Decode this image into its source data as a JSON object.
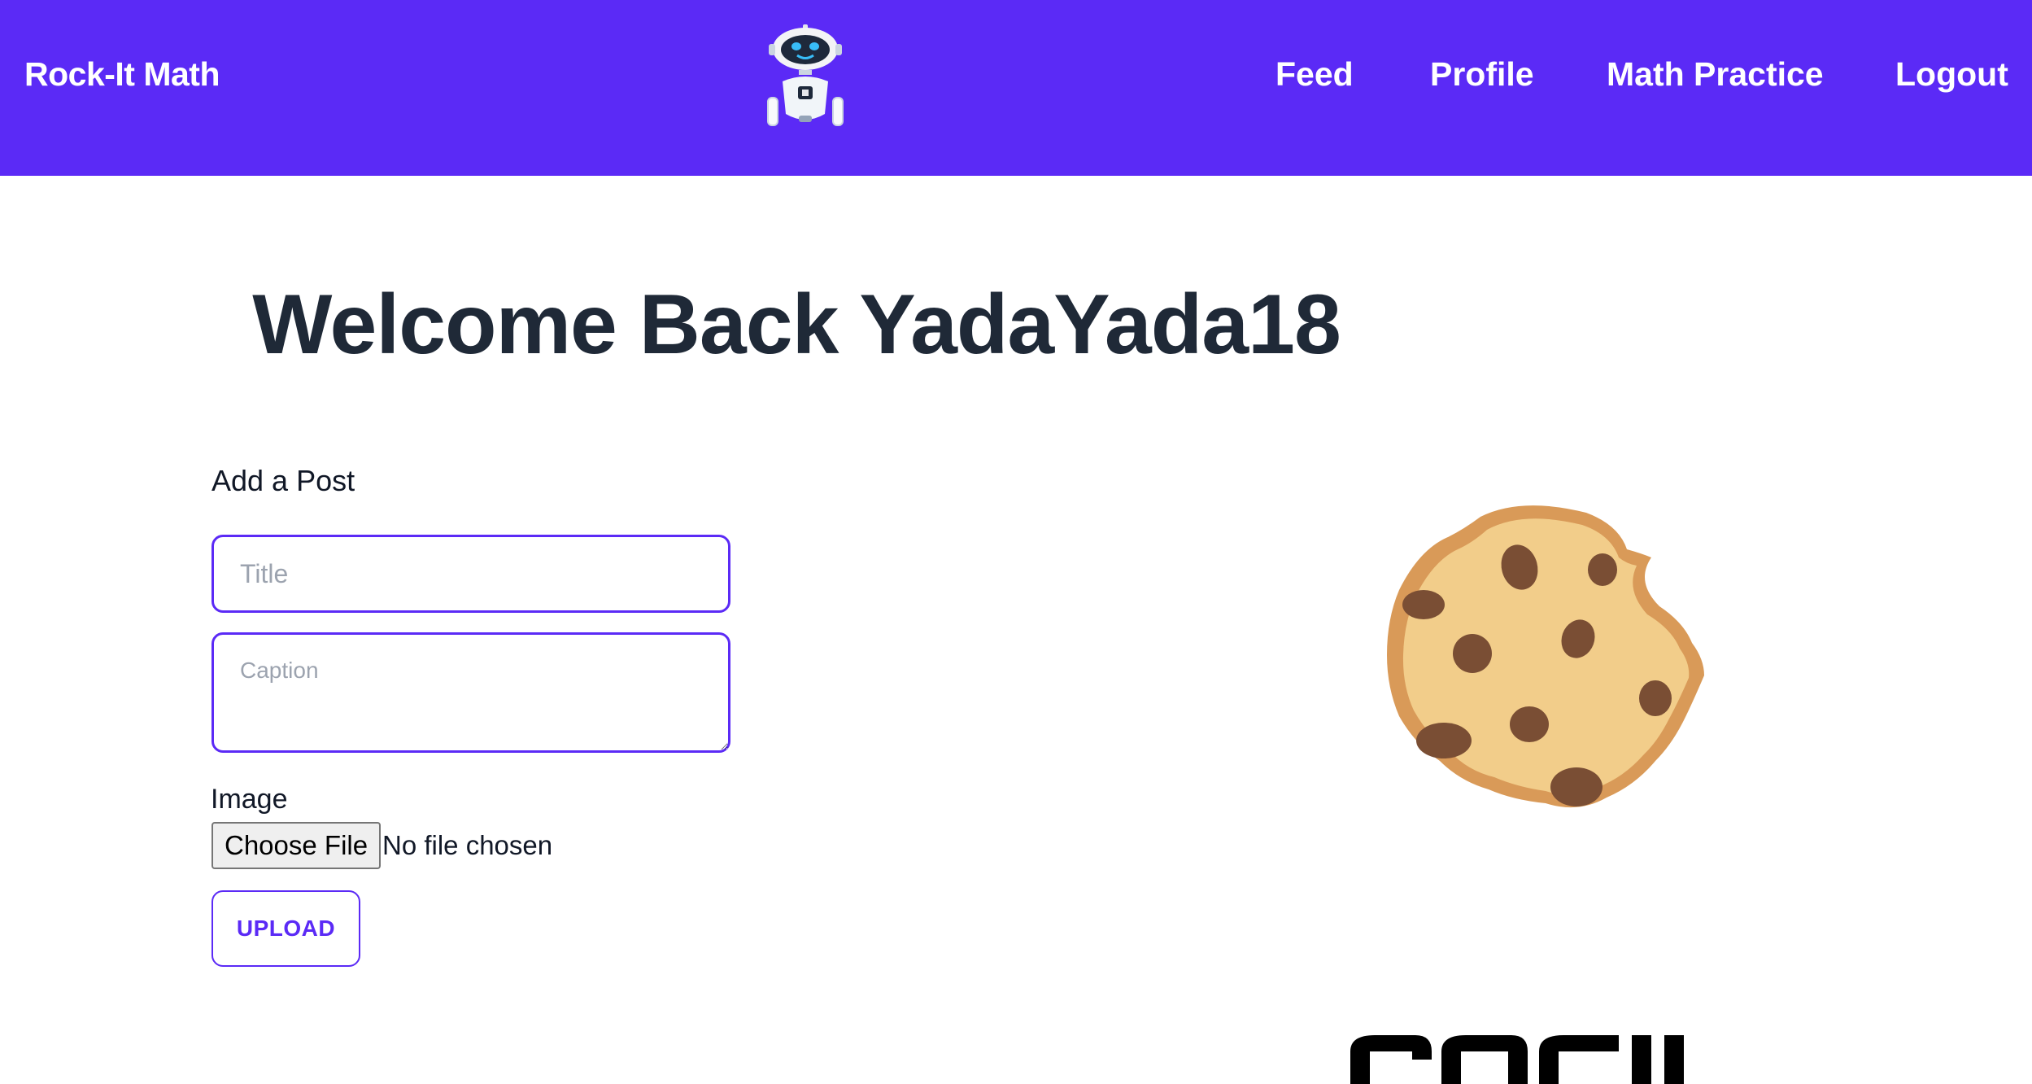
{
  "navbar": {
    "brand": "Rock-It Math",
    "logo_icon": "robot-icon",
    "links": [
      "Feed",
      "Profile",
      "Math Practice",
      "Logout"
    ],
    "color": "#5b2af6"
  },
  "main": {
    "welcome": "Welcome Back YadaYada18"
  },
  "post_form": {
    "heading": "Add a Post",
    "title_placeholder": "Title",
    "caption_placeholder": "Caption",
    "image_label": "Image",
    "file_button_label": "Choose File",
    "file_status": "No file chosen",
    "upload_label": "UPLOAD"
  },
  "illustrations": {
    "cookie_icon": "cookie-icon",
    "bottom_logo": "rocket-logo"
  }
}
